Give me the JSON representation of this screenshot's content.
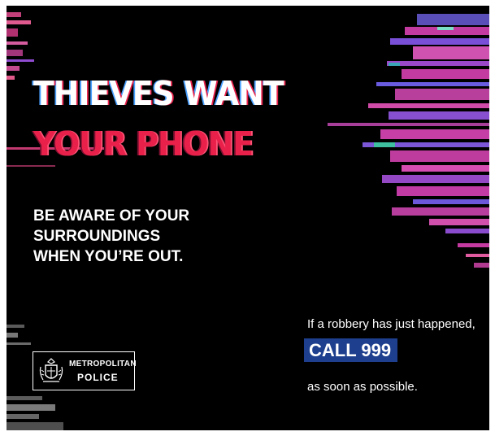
{
  "headline": {
    "line1": "THIEVES WANT",
    "line2": "YOUR PHONE"
  },
  "advice": [
    "BE AWARE OF YOUR",
    "SURROUNDINGS",
    "WHEN YOU’RE OUT."
  ],
  "call_to_action": {
    "lead": "If a robbery has just happened,",
    "emphasis": "CALL 999",
    "tail": "as soon as possible."
  },
  "logo": {
    "line1": "METROPOLITAN",
    "line2": "POLICE"
  },
  "colors": {
    "background": "#000000",
    "accent_red": "#e8204a",
    "cta_blue": "#1d3f8e",
    "glitch_pink": "#c33aa0",
    "glitch_purple": "#7a4fd8"
  },
  "icons": {
    "logo_crest": "police-crest-icon"
  }
}
